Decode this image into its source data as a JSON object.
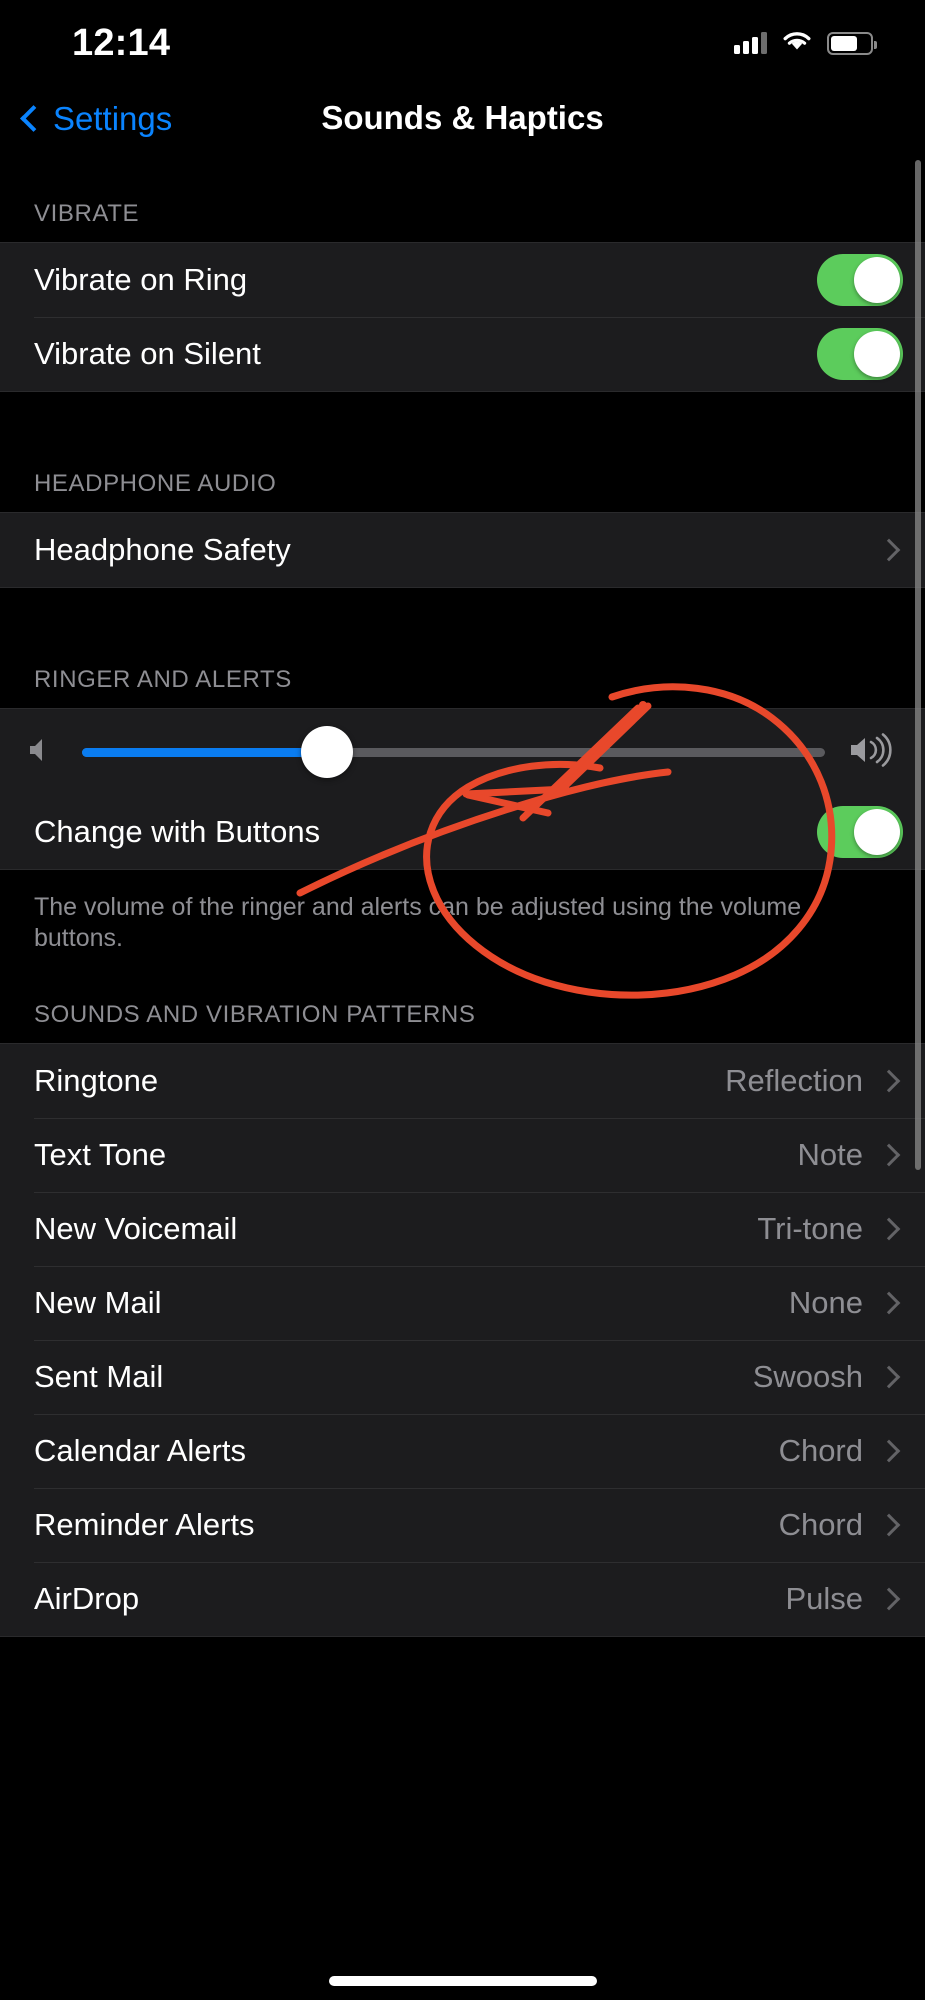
{
  "status_bar": {
    "time": "12:14",
    "signal_icon": "cellular-signal-icon",
    "wifi_icon": "wifi-icon",
    "battery_icon": "battery-icon"
  },
  "nav": {
    "back_label": "Settings",
    "title": "Sounds & Haptics",
    "back_icon": "chevron-left-icon",
    "accent_color": "#0a84ff"
  },
  "sections": {
    "vibrate": {
      "header": "VIBRATE",
      "rows": [
        {
          "label": "Vibrate on Ring",
          "toggle": "on"
        },
        {
          "label": "Vibrate on Silent",
          "toggle": "on"
        }
      ]
    },
    "headphone_audio": {
      "header": "HEADPHONE AUDIO",
      "rows": [
        {
          "label": "Headphone Safety",
          "value": "",
          "chevron": true
        }
      ]
    },
    "ringer_alerts": {
      "header": "RINGER AND ALERTS",
      "slider": {
        "value_percent": 33,
        "low_icon": "speaker-low-icon",
        "high_icon": "speaker-high-icon",
        "fill_color": "#0a7cf0",
        "track_color": "#5a5a5e"
      },
      "change_with_buttons": {
        "label": "Change with Buttons",
        "toggle": "on"
      },
      "footer": "The volume of the ringer and alerts can be adjusted using the volume buttons."
    },
    "sounds_patterns": {
      "header": "SOUNDS AND VIBRATION PATTERNS",
      "rows": [
        {
          "label": "Ringtone",
          "value": "Reflection"
        },
        {
          "label": "Text Tone",
          "value": "Note"
        },
        {
          "label": "New Voicemail",
          "value": "Tri-tone"
        },
        {
          "label": "New Mail",
          "value": "None"
        },
        {
          "label": "Sent Mail",
          "value": "Swoosh"
        },
        {
          "label": "Calendar Alerts",
          "value": "Chord"
        },
        {
          "label": "Reminder Alerts",
          "value": "Chord"
        },
        {
          "label": "AirDrop",
          "value": "Pulse"
        }
      ]
    }
  },
  "annotation": {
    "color": "#e8482b",
    "description": "hand-drawn-circle-and-arrow"
  },
  "colors": {
    "toggle_on": "#5ccc5c",
    "row_background": "#1c1c1e",
    "page_background": "#000000",
    "secondary_text": "#8e8e93"
  }
}
